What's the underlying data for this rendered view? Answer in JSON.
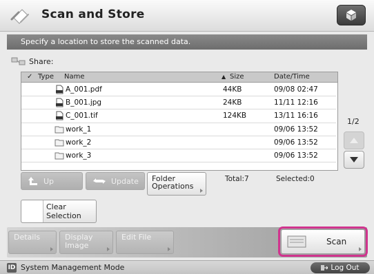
{
  "header": {
    "title": "Scan and Store",
    "top_button_icon": "box-icon"
  },
  "instruction": "Specify a location to store the scanned data.",
  "share": {
    "label": "Share:"
  },
  "table": {
    "columns": {
      "check": "✓",
      "type": "Type",
      "name": "Name",
      "size": "Size",
      "date": "Date/Time"
    },
    "sort_indicator": "▲",
    "rows": [
      {
        "type": "pdf-icon",
        "name": "A_001.pdf",
        "size": "44KB",
        "date": "09/08  02:47"
      },
      {
        "type": "jpg-icon",
        "name": "B_001.jpg",
        "size": "24KB",
        "date": "11/11  12:16"
      },
      {
        "type": "tif-icon",
        "name": "C_001.tif",
        "size": "124KB",
        "date": "13/11  16:16"
      },
      {
        "type": "folder-icon",
        "name": "work_1",
        "size": "",
        "date": "09/06  13:52"
      },
      {
        "type": "folder-icon",
        "name": "work_2",
        "size": "",
        "date": "09/06  13:52"
      },
      {
        "type": "folder-icon",
        "name": "work_3",
        "size": "",
        "date": "09/06  13:52"
      }
    ]
  },
  "pager": {
    "page": "1/2"
  },
  "buttons": {
    "up": "Up",
    "update": "Update",
    "folder_line1": "Folder",
    "folder_line2": "Operations",
    "clear_line1": "Clear",
    "clear_line2": "Selection",
    "details": "Details",
    "display_line1": "Display",
    "display_line2": "Image",
    "edit_file": "Edit File",
    "scan": "Scan"
  },
  "totals": {
    "total": "Total:7",
    "selected": "Selected:0"
  },
  "status": {
    "mode": "System Management Mode",
    "logout": "Log Out",
    "id_badge": "ID"
  },
  "colors": {
    "highlight": "#d0348e",
    "instruction_bg": "#7b7b7b"
  }
}
